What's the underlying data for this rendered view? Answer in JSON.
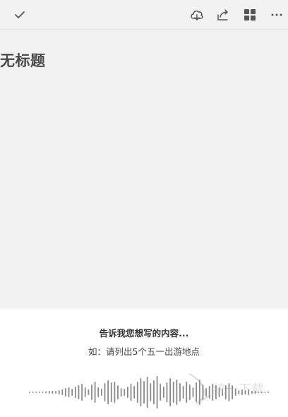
{
  "toolbar": {
    "done_icon": "checkmark-icon",
    "cloud_icon": "cloud-sync-icon",
    "share_icon": "share-icon",
    "grid_icon": "grid-icon",
    "more_icon": "more-icon"
  },
  "note": {
    "title": "无标题"
  },
  "voice": {
    "prompt": "告诉我您想写的内容...",
    "hint": "如：请列出5个五一出游地点",
    "waveform": [
      2,
      2,
      2,
      2,
      2,
      3,
      4,
      4,
      4,
      6,
      8,
      12,
      14,
      10,
      16,
      20,
      24,
      14,
      8,
      22,
      30,
      14,
      10,
      26,
      34,
      28,
      30,
      20,
      12,
      10,
      16,
      24,
      18,
      30,
      40,
      32,
      44,
      26,
      34,
      46,
      24,
      16,
      28,
      40,
      30,
      36,
      26,
      18,
      30,
      22,
      14,
      28,
      36,
      22,
      12,
      18,
      24,
      20,
      14,
      10,
      20,
      26,
      20,
      10,
      6,
      8,
      6,
      8,
      4,
      4,
      2,
      2,
      2,
      2
    ],
    "wave_color": "#8a8a8a"
  },
  "watermark": {
    "text": "统一下载"
  }
}
